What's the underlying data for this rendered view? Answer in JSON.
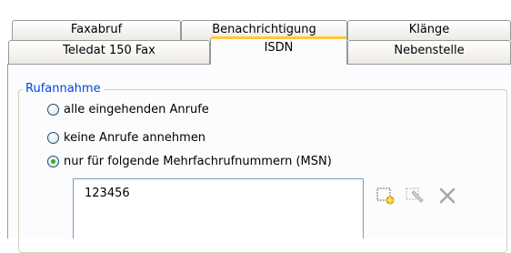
{
  "tabs": {
    "row1": [
      {
        "label": "Faxabruf"
      },
      {
        "label": "Benachrichtigung"
      },
      {
        "label": "Klänge"
      }
    ],
    "row2": [
      {
        "label": "Teledat 150 Fax"
      },
      {
        "label": "ISDN",
        "active": true
      },
      {
        "label": "Nebenstelle"
      }
    ]
  },
  "group": {
    "title": "Rufannahme",
    "options": [
      {
        "label": "alle eingehenden Anrufe",
        "checked": false
      },
      {
        "label": "keine Anrufe annehmen",
        "checked": false
      },
      {
        "label": "nur für folgende Mehrfachrufnummern (MSN)",
        "checked": true
      }
    ]
  },
  "msn_list": {
    "items": [
      "123456"
    ]
  },
  "toolbar": {
    "icons": [
      "new-entry-icon",
      "edit-entry-icon",
      "delete-icon"
    ]
  }
}
